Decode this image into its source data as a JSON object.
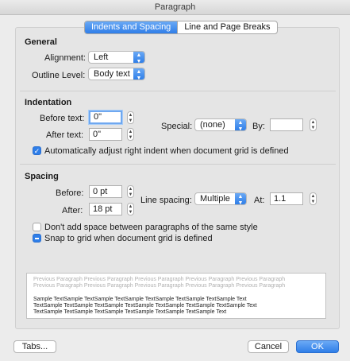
{
  "window": {
    "title": "Paragraph"
  },
  "tabs": [
    {
      "label": "Indents and Spacing",
      "active": true
    },
    {
      "label": "Line and Page Breaks",
      "active": false
    }
  ],
  "general": {
    "heading": "General",
    "alignment_label": "Alignment:",
    "alignment_value": "Left",
    "outline_label": "Outline Level:",
    "outline_value": "Body text"
  },
  "indentation": {
    "heading": "Indentation",
    "before_label": "Before text:",
    "before_value": "0\"",
    "after_label": "After text:",
    "after_value": "0\"",
    "special_label": "Special:",
    "special_value": "(none)",
    "by_label": "By:",
    "by_value": "",
    "auto_adjust_label": "Automatically adjust right indent when document grid is defined",
    "auto_adjust_checked": true
  },
  "spacing": {
    "heading": "Spacing",
    "before_label": "Before:",
    "before_value": "0 pt",
    "after_label": "After:",
    "after_value": "18 pt",
    "line_spacing_label": "Line spacing:",
    "line_spacing_value": "Multiple",
    "at_label": "At:",
    "at_value": "1.1",
    "no_space_label": "Don't add space between paragraphs of the same style",
    "no_space_checked": false,
    "snap_label": "Snap to grid when document grid is defined",
    "snap_state": "mixed"
  },
  "preview": {
    "previous_line1": "Previous Paragraph Previous Paragraph Previous Paragraph Previous Paragraph Previous Paragraph",
    "previous_line2": "Previous Paragraph Previous Paragraph Previous Paragraph Previous Paragraph Previous Paragraph",
    "sample_line1": "Sample TextSample TextSample TextSample TextSample TextSample TextSample Text",
    "sample_line2": "TextSample TextSample TextSample TextSample TextSample TextSample TextSample Text",
    "sample_line3": "TextSample TextSample TextSample TextSample TextSample TextSample Text"
  },
  "buttons": {
    "tabs": "Tabs...",
    "cancel": "Cancel",
    "ok": "OK"
  },
  "icons": {
    "checkmark": "check-icon",
    "popup_arrows": "up-down-chevron-icon",
    "stepper": "stepper-icon"
  },
  "colors": {
    "accent": "#2f7ee8",
    "window_bg": "#ececec"
  }
}
